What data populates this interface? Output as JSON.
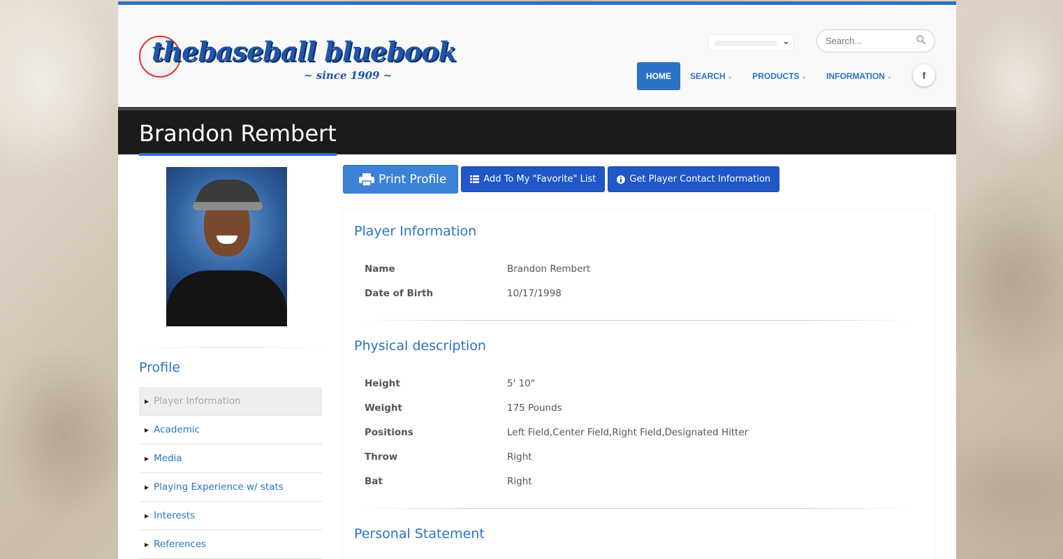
{
  "header": {
    "logo_the": "the",
    "logo_text": "baseball bluebook",
    "logo_since": "~ since 1909 ~",
    "search_placeholder": "Search...",
    "nav": [
      {
        "label": "HOME"
      },
      {
        "label": "SEARCH"
      },
      {
        "label": "PRODUCTS"
      },
      {
        "label": "INFORMATION"
      }
    ],
    "facebook_label": "f"
  },
  "page_title": "Brandon Rembert",
  "sidebar": {
    "profile_heading": "Profile",
    "links": [
      {
        "label": "Player Information",
        "active": true
      },
      {
        "label": "Academic"
      },
      {
        "label": "Media"
      },
      {
        "label": "Playing Experience w/ stats"
      },
      {
        "label": "Interests"
      },
      {
        "label": "References"
      }
    ]
  },
  "actions": {
    "print": "Print Profile",
    "favorite": "Add To My \"Favorite\" List",
    "contact": "Get Player Contact Information"
  },
  "sections": {
    "player_info": {
      "title": "Player Information",
      "rows": [
        {
          "label": "Name",
          "value": "Brandon Rembert"
        },
        {
          "label": "Date of Birth",
          "value": "10/17/1998"
        }
      ]
    },
    "physical": {
      "title": "Physical description",
      "rows": [
        {
          "label": "Height",
          "value": "5' 10\""
        },
        {
          "label": "Weight",
          "value": "175 Pounds"
        },
        {
          "label": "Positions",
          "value": "Left Field,Center Field,Right Field,Designated Hitter"
        },
        {
          "label": "Throw",
          "value": "Right"
        },
        {
          "label": "Bat",
          "value": "Right"
        }
      ]
    },
    "statement": {
      "title": "Personal Statement"
    }
  },
  "colors": {
    "brand_blue": "#2a73c5",
    "button_blue": "#1f57c9",
    "title_bar": "#1b1b1b"
  }
}
